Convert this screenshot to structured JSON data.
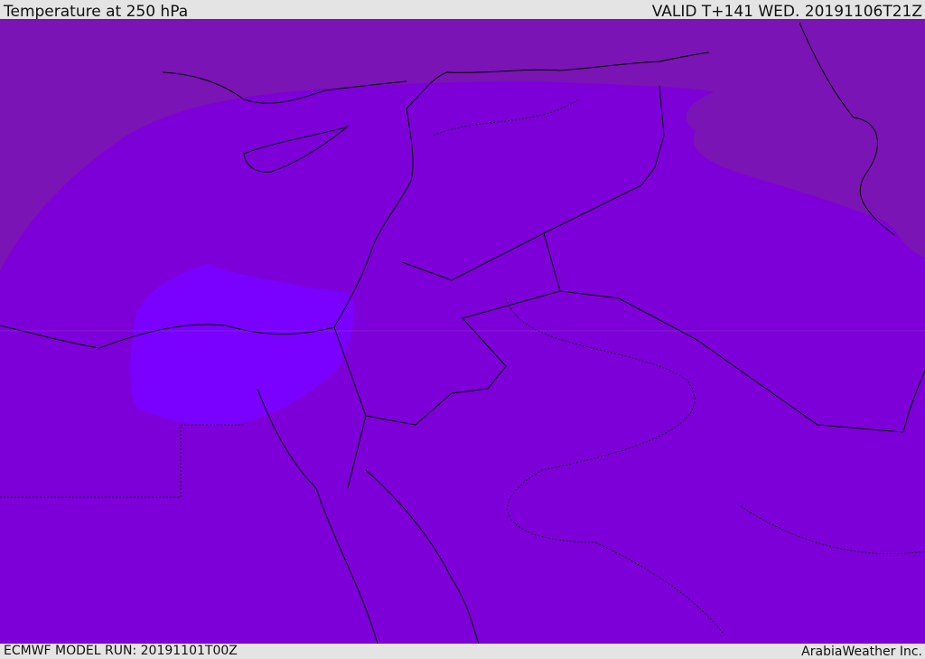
{
  "header": {
    "title": "Temperature at 250 hPa",
    "valid": "VALID T+141 WED. 20191106T21Z"
  },
  "footer": {
    "model_run": "ECMWF MODEL RUN: 20191101T00Z",
    "credit": "ArabiaWeather Inc."
  },
  "colors": {
    "cold_outer": "#7a14b4",
    "main": "#7d00d8",
    "warm_core": "#7a00ff",
    "border": "#000000"
  }
}
